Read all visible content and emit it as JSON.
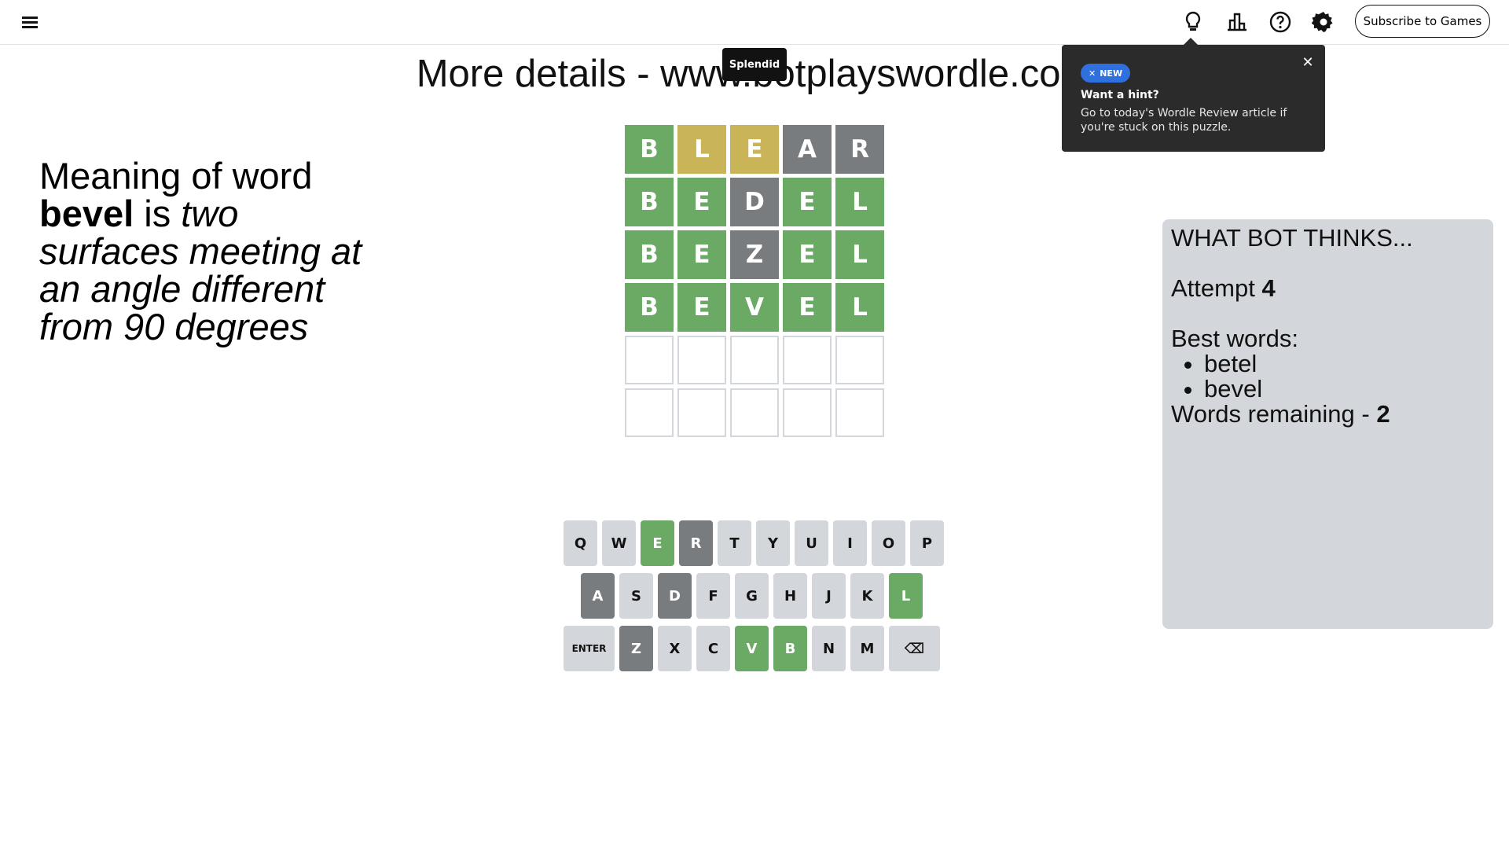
{
  "header": {
    "subscribe_label": "Subscribe to Games"
  },
  "banner": "More details - www.botplayswordle.com",
  "toast": "Splendid",
  "meaning": {
    "prefix": "Meaning of word",
    "word": "bevel",
    "is": "is",
    "definition": "two surfaces meeting at an angle different from 90 degrees"
  },
  "board": {
    "rows": [
      [
        {
          "l": "B",
          "s": "correct"
        },
        {
          "l": "L",
          "s": "present"
        },
        {
          "l": "E",
          "s": "present"
        },
        {
          "l": "A",
          "s": "absent"
        },
        {
          "l": "R",
          "s": "absent"
        }
      ],
      [
        {
          "l": "B",
          "s": "correct"
        },
        {
          "l": "E",
          "s": "correct"
        },
        {
          "l": "D",
          "s": "absent"
        },
        {
          "l": "E",
          "s": "correct"
        },
        {
          "l": "L",
          "s": "correct"
        }
      ],
      [
        {
          "l": "B",
          "s": "correct"
        },
        {
          "l": "E",
          "s": "correct"
        },
        {
          "l": "Z",
          "s": "absent"
        },
        {
          "l": "E",
          "s": "correct"
        },
        {
          "l": "L",
          "s": "correct"
        }
      ],
      [
        {
          "l": "B",
          "s": "correct"
        },
        {
          "l": "E",
          "s": "correct"
        },
        {
          "l": "V",
          "s": "correct"
        },
        {
          "l": "E",
          "s": "correct"
        },
        {
          "l": "L",
          "s": "correct"
        }
      ],
      [
        {
          "l": "",
          "s": "empty"
        },
        {
          "l": "",
          "s": "empty"
        },
        {
          "l": "",
          "s": "empty"
        },
        {
          "l": "",
          "s": "empty"
        },
        {
          "l": "",
          "s": "empty"
        }
      ],
      [
        {
          "l": "",
          "s": "empty"
        },
        {
          "l": "",
          "s": "empty"
        },
        {
          "l": "",
          "s": "empty"
        },
        {
          "l": "",
          "s": "empty"
        },
        {
          "l": "",
          "s": "empty"
        }
      ]
    ]
  },
  "keyboard": {
    "rows": [
      [
        {
          "k": "Q",
          "s": ""
        },
        {
          "k": "W",
          "s": ""
        },
        {
          "k": "E",
          "s": "correct"
        },
        {
          "k": "R",
          "s": "absent"
        },
        {
          "k": "T",
          "s": ""
        },
        {
          "k": "Y",
          "s": ""
        },
        {
          "k": "U",
          "s": ""
        },
        {
          "k": "I",
          "s": ""
        },
        {
          "k": "O",
          "s": ""
        },
        {
          "k": "P",
          "s": ""
        }
      ],
      [
        {
          "k": "A",
          "s": "absent"
        },
        {
          "k": "S",
          "s": ""
        },
        {
          "k": "D",
          "s": "absent"
        },
        {
          "k": "F",
          "s": ""
        },
        {
          "k": "G",
          "s": ""
        },
        {
          "k": "H",
          "s": ""
        },
        {
          "k": "J",
          "s": ""
        },
        {
          "k": "K",
          "s": ""
        },
        {
          "k": "L",
          "s": "correct"
        }
      ],
      [
        {
          "k": "ENTER",
          "s": ""
        },
        {
          "k": "Z",
          "s": "absent"
        },
        {
          "k": "X",
          "s": ""
        },
        {
          "k": "C",
          "s": ""
        },
        {
          "k": "V",
          "s": "correct"
        },
        {
          "k": "B",
          "s": "correct"
        },
        {
          "k": "N",
          "s": ""
        },
        {
          "k": "M",
          "s": ""
        },
        {
          "k": "⌫",
          "s": ""
        }
      ]
    ]
  },
  "hint": {
    "badge": "NEW",
    "title": "Want a hint?",
    "body": "Go to today's Wordle Review article if you're stuck on this puzzle."
  },
  "bot": {
    "heading": "WHAT BOT THINKS...",
    "attempt_label": "Attempt",
    "attempt_value": "4",
    "best_label": "Best words:",
    "best_words": [
      "betel",
      "bevel"
    ],
    "remaining_label": "Words remaining -",
    "remaining_value": "2"
  },
  "colors": {
    "correct": "#6aaa64",
    "present": "#c9b458",
    "absent": "#787c7e",
    "key": "#d3d6da",
    "panel": "#d3d6da"
  }
}
